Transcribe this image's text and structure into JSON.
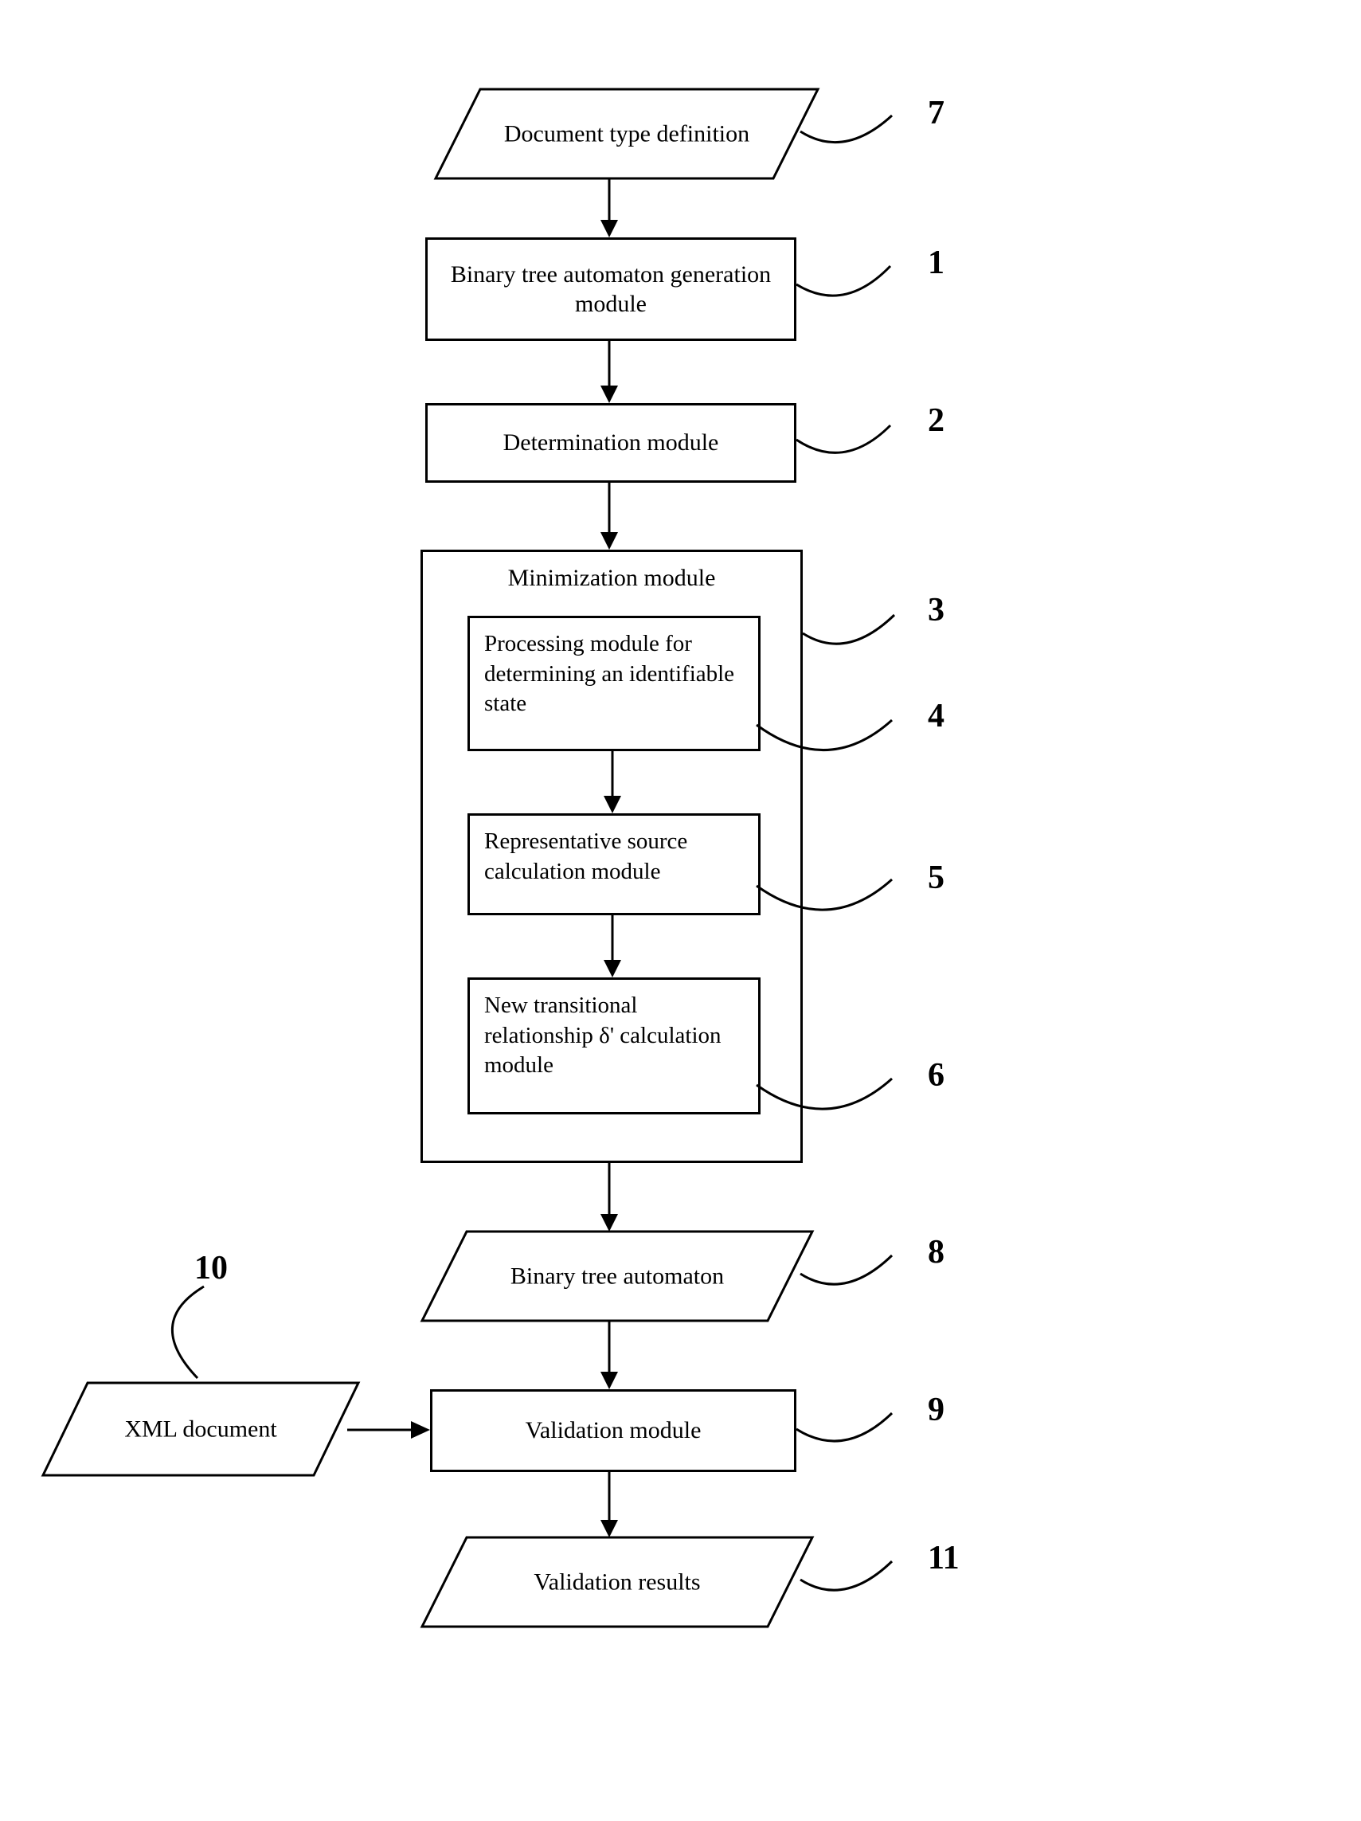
{
  "nodes": {
    "n7": {
      "label": "Document type definition"
    },
    "n1": {
      "label": "Binary tree automaton generation module"
    },
    "n2": {
      "label": "Determination module"
    },
    "n3": {
      "title": "Minimization module"
    },
    "n4": {
      "label": "Processing module for determining an identifiable state"
    },
    "n5": {
      "label": "Representative source calculation module"
    },
    "n6": {
      "label": "New transitional relationship δ' calculation module"
    },
    "n8": {
      "label": "Binary tree automaton"
    },
    "n9": {
      "label": "Validation module"
    },
    "n10": {
      "label": "XML document"
    },
    "n11": {
      "label": "Validation results"
    }
  },
  "labels": {
    "l7": "7",
    "l1": "1",
    "l2": "2",
    "l3": "3",
    "l4": "4",
    "l5": "5",
    "l6": "6",
    "l8": "8",
    "l9": "9",
    "l10": "10",
    "l11": "11"
  }
}
